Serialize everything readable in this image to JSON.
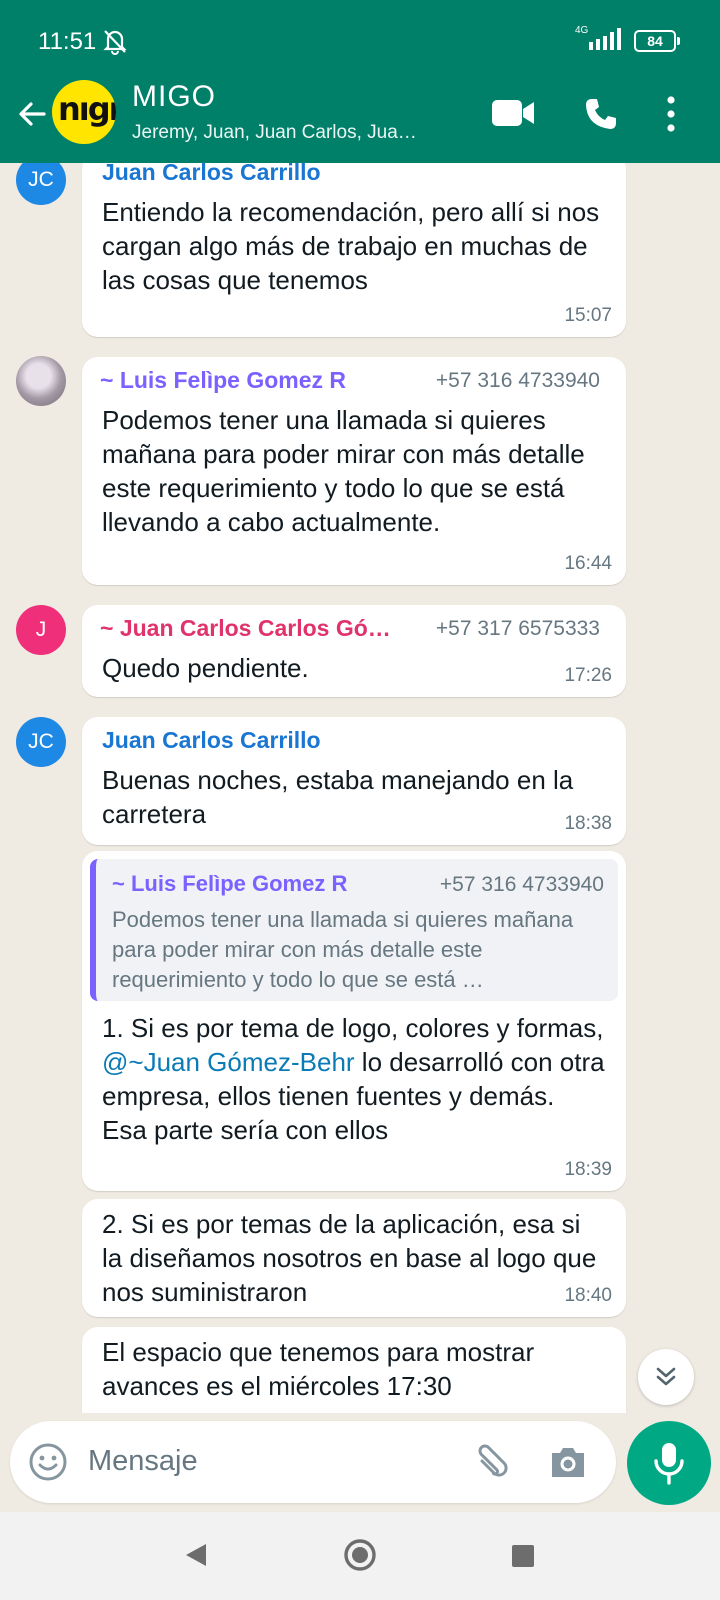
{
  "status_bar": {
    "time": "11:51",
    "network": "4G",
    "battery": "84"
  },
  "header": {
    "group_logo": "nıgı",
    "title": "MIGO",
    "subtitle": "Jeremy, Juan, Juan Carlos, Jua…"
  },
  "messages": [
    {
      "avatar": "JC",
      "sender": "Juan Carlos Carrillo",
      "text": "Entiendo la recomendación, pero allí si nos cargan algo más de trabajo en muchas de las cosas que tenemos",
      "time": "15:07"
    },
    {
      "avatar": "",
      "sender": "~ Luis Felìpe Gomez R",
      "phone": "+57 316 4733940",
      "text": "Podemos tener una llamada si quieres mañana para poder mirar con más detalle este requerimiento y todo lo que se está llevando a cabo actualmente.",
      "time": "16:44"
    },
    {
      "avatar": "J",
      "sender": "~ Juan Carlos Carlos Gó…",
      "phone": "+57 317 6575333",
      "text": "Quedo pendiente.",
      "time": "17:26"
    },
    {
      "avatar": "JC",
      "sender": "Juan Carlos Carrillo",
      "text": "Buenas noches, estaba manejando en la carretera",
      "time": "18:38"
    },
    {
      "quote": {
        "sender": "~ Luis Felìpe Gomez R",
        "phone": "+57 316 4733940",
        "text": "Podemos tener una llamada si quieres mañana para poder mirar con más detalle este requerimiento y todo lo que se está …"
      },
      "text_before": "1. Si es por tema de logo, colores y formas, ",
      "mention": "@~Juan Gómez-Behr",
      "text_after": " lo desarrolló con otra empresa, ellos tienen fuentes y demás. Esa parte sería con ellos",
      "time": "18:39"
    },
    {
      "text": "2. Si es por temas de la aplicación, esa si la diseñamos nosotros en base al  logo que nos suministraron",
      "time": "18:40"
    },
    {
      "text": "El espacio que tenemos para mostrar avances es el miércoles 17:30"
    }
  ],
  "composer": {
    "placeholder": "Mensaje"
  },
  "colors": {
    "header": "#008069",
    "accent": "#00a884",
    "chat_bg": "#efeae2"
  },
  "icons": [
    "back-arrow-icon",
    "video-call-icon",
    "phone-icon",
    "more-vert-icon",
    "chevrons-down-icon",
    "emoji-icon",
    "attach-icon",
    "camera-icon",
    "mic-icon"
  ]
}
